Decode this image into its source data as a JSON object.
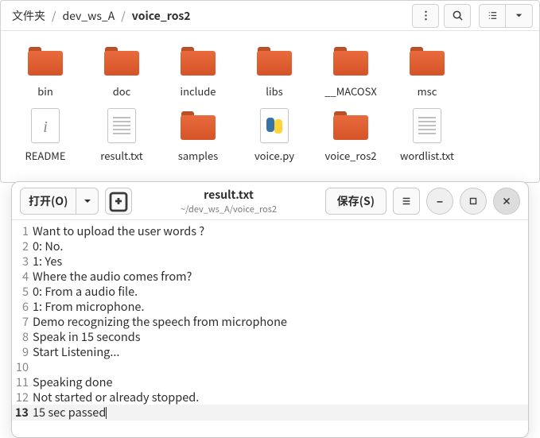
{
  "fm": {
    "breadcrumb": [
      "文件夹",
      "dev_ws_A",
      "voice_ros2"
    ],
    "items": [
      {
        "name": "bin",
        "type": "folder"
      },
      {
        "name": "doc",
        "type": "folder"
      },
      {
        "name": "include",
        "type": "folder"
      },
      {
        "name": "libs",
        "type": "folder"
      },
      {
        "name": "__MACOSX",
        "type": "folder"
      },
      {
        "name": "msc",
        "type": "folder"
      },
      {
        "name": "README",
        "type": "readme"
      },
      {
        "name": "result.txt",
        "type": "txt"
      },
      {
        "name": "samples",
        "type": "folder"
      },
      {
        "name": "voice.py",
        "type": "py"
      },
      {
        "name": "voice_ros2",
        "type": "folder"
      },
      {
        "name": "wordlist.txt",
        "type": "txt"
      }
    ]
  },
  "ed": {
    "open": "打开(O)",
    "save": "保存(S)",
    "title": "result.txt",
    "path": "~/dev_ws_A/voice_ros2",
    "lines": [
      "Want to upload the user words ?",
      "0: No.",
      "1: Yes",
      "Where the audio comes from?",
      "0: From a audio file.",
      "1: From microphone.",
      "Demo recognizing the speech from microphone",
      "Speak in 15 seconds",
      "Start Listening...",
      "",
      "Speaking done",
      "Not started or already stopped.",
      "15 sec passed"
    ],
    "current_line": 13
  }
}
